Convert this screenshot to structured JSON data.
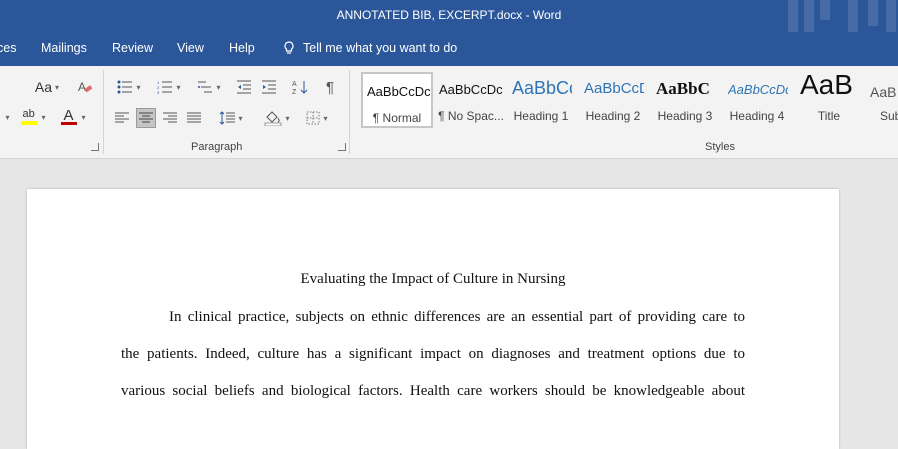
{
  "window": {
    "title": "ANNOTATED BIB, EXCERPT.docx  -  Word"
  },
  "tabs": [
    "ces",
    "Mailings",
    "Review",
    "View",
    "Help"
  ],
  "tell_me": "Tell me what you want to do",
  "ribbon": {
    "font_group": {
      "grow_shrink": "Aa",
      "highlight": "ab",
      "font_color": "A",
      "clear_format": "A"
    },
    "paragraph_label": "Paragraph",
    "styles_label": "Styles",
    "styles": [
      {
        "sample": "AaBbCcDc",
        "label": "¶ Normal"
      },
      {
        "sample": "AaBbCcDc",
        "label": "¶ No Spac..."
      },
      {
        "sample": "AaBbCc",
        "label": "Heading 1"
      },
      {
        "sample": "AaBbCcD",
        "label": "Heading 2"
      },
      {
        "sample": "AaBbC",
        "label": "Heading 3"
      },
      {
        "sample": "AaBbCcDc",
        "label": "Heading 4"
      },
      {
        "sample": "AaB",
        "label": "Title"
      },
      {
        "sample": "AaB",
        "label": "Sub"
      }
    ]
  },
  "document": {
    "title": "Evaluating the Impact of Culture in Nursing",
    "lines": [
      "In clinical practice, subjects on ethnic differences are an essential part of providing care to",
      "the patients. Indeed, culture has a significant impact on diagnoses and treatment options due to",
      "various social beliefs and biological factors. Health care workers should be knowledgeable about"
    ]
  },
  "colors": {
    "titlebar": "#2b579a",
    "highlight": "#ffff00",
    "font_color": "#c00000",
    "heading_blue": "#2e74b5"
  }
}
